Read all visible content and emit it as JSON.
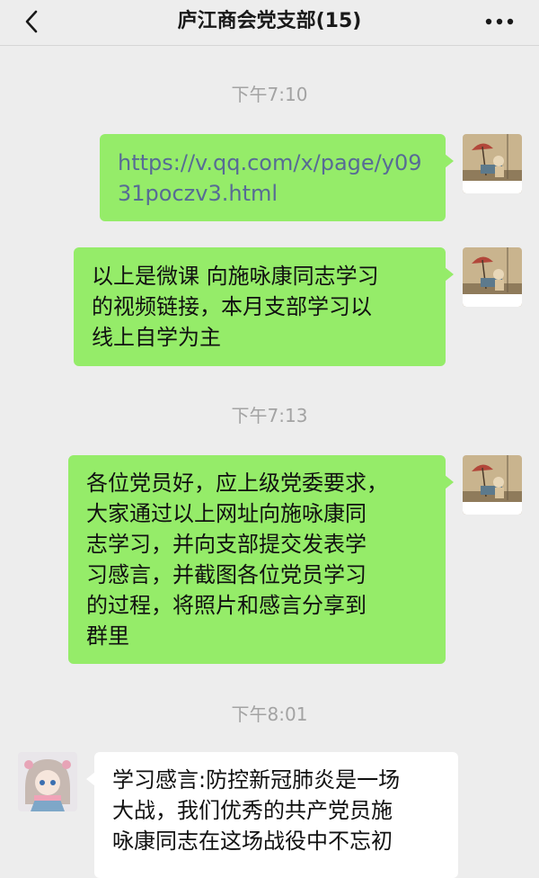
{
  "header": {
    "title": "庐江商会党支部(15)",
    "back_icon": "chevron-left-icon",
    "more_icon": "more-dots-icon"
  },
  "colors": {
    "outgoing_bubble": "#95ec69",
    "incoming_bubble": "#ffffff",
    "link": "#576b95",
    "background": "#ededed"
  },
  "messages": {
    "time1": "下午7:10",
    "msg1_line1": "https://v.qq.com/x/page/y09",
    "msg1_line2": "31poczv3.html",
    "msg2_line1": "以上是微课 向施咏康同志学习",
    "msg2_line2": "的视频链接，本月支部学习以",
    "msg2_line3": "线上自学为主",
    "time2": "下午7:13",
    "msg3_line1": "各位党员好，应上级党委要求，",
    "msg3_line2": "大家通过以上网址向施咏康同",
    "msg3_line3": "志学习，并向支部提交发表学",
    "msg3_line4": "习感言，并截图各位党员学习",
    "msg3_line5": "的过程，将照片和感言分享到",
    "msg3_line6": "群里",
    "time3": "下午8:01",
    "msg4_line1": "学习感言:防控新冠肺炎是一场",
    "msg4_line2": "大战，我们优秀的共产党员施",
    "msg4_line3": "咏康同志在这场战役中不忘初"
  }
}
